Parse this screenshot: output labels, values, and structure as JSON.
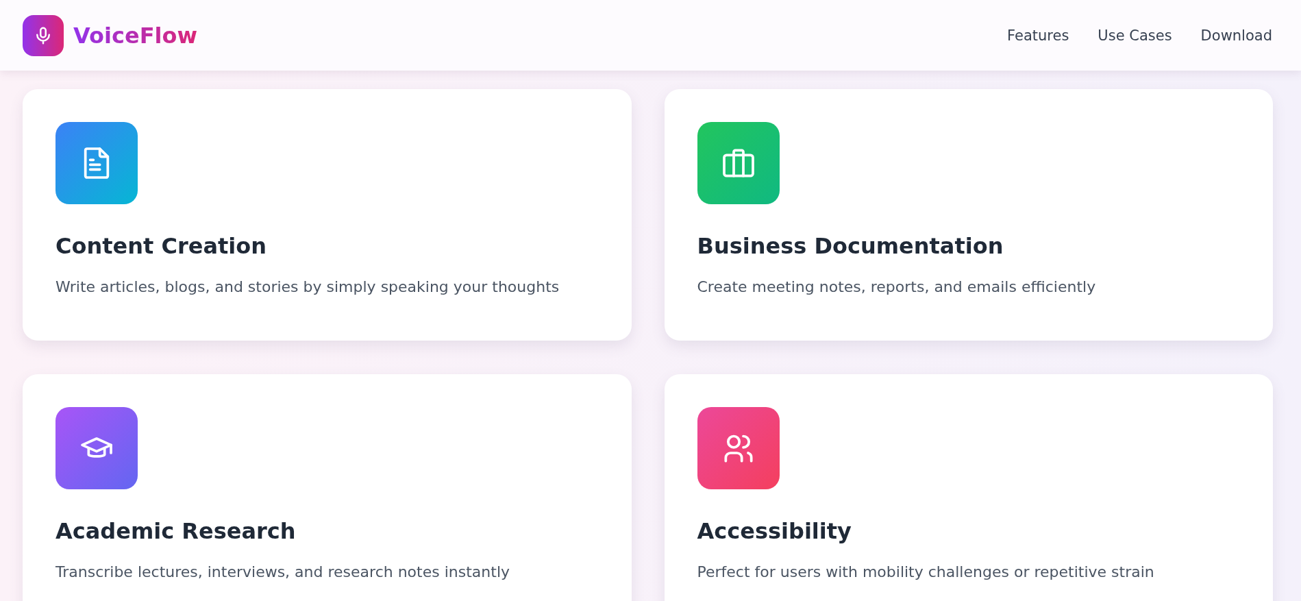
{
  "header": {
    "brand": "VoiceFlow",
    "nav": [
      {
        "label": "Features"
      },
      {
        "label": "Use Cases"
      },
      {
        "label": "Download"
      }
    ]
  },
  "use_cases": [
    {
      "kind": "document",
      "title": "Content Creation",
      "description": "Write articles, blogs, and stories by simply speaking your thoughts"
    },
    {
      "kind": "briefcase",
      "title": "Business Documentation",
      "description": "Create meeting notes, reports, and emails efficiently"
    },
    {
      "kind": "graduation",
      "title": "Academic Research",
      "description": "Transcribe lectures, interviews, and research notes instantly"
    },
    {
      "kind": "people",
      "title": "Accessibility",
      "description": "Perfect for users with mobility challenges or repetitive strain"
    }
  ]
}
